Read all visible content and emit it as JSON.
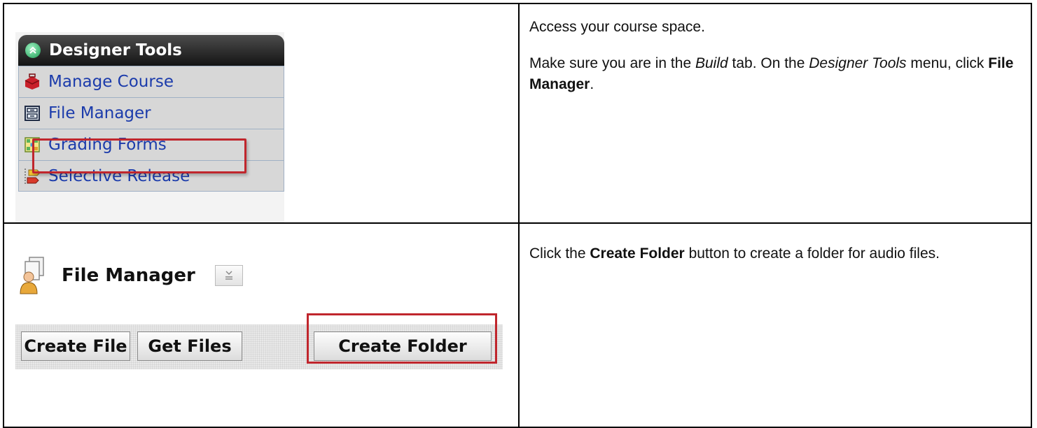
{
  "designer_tools": {
    "title": "Designer Tools",
    "items": [
      {
        "label": "Manage Course",
        "icon": "toolbox-icon"
      },
      {
        "label": "File Manager",
        "icon": "file-cabinet-icon"
      },
      {
        "label": "Grading Forms",
        "icon": "grid-icon"
      },
      {
        "label": "Selective Release",
        "icon": "flowchart-icon"
      }
    ],
    "highlighted_item": "File Manager",
    "colors": {
      "header_bg": "#1e1e1e",
      "item_bg": "#d7d7d7",
      "link": "#1b3bab",
      "highlight": "#c0262d"
    }
  },
  "file_manager": {
    "title": "File Manager",
    "buttons": [
      "Create File",
      "Get Files",
      "Create Folder"
    ],
    "highlighted_button": "Create Folder"
  },
  "instructions": {
    "row1": {
      "p1": "Access your course space.",
      "p2": {
        "t1": "Make sure you are in the ",
        "t2_italic": "Build",
        "t3": " tab.  On the ",
        "t4_italic": "Designer Tools",
        "t5": " menu, click ",
        "t6_bold": "File Manager",
        "t7": "."
      }
    },
    "row2": {
      "t1": "Click the ",
      "t2_bold": "Create Folder",
      "t3": " button to create a folder for audio files."
    }
  }
}
